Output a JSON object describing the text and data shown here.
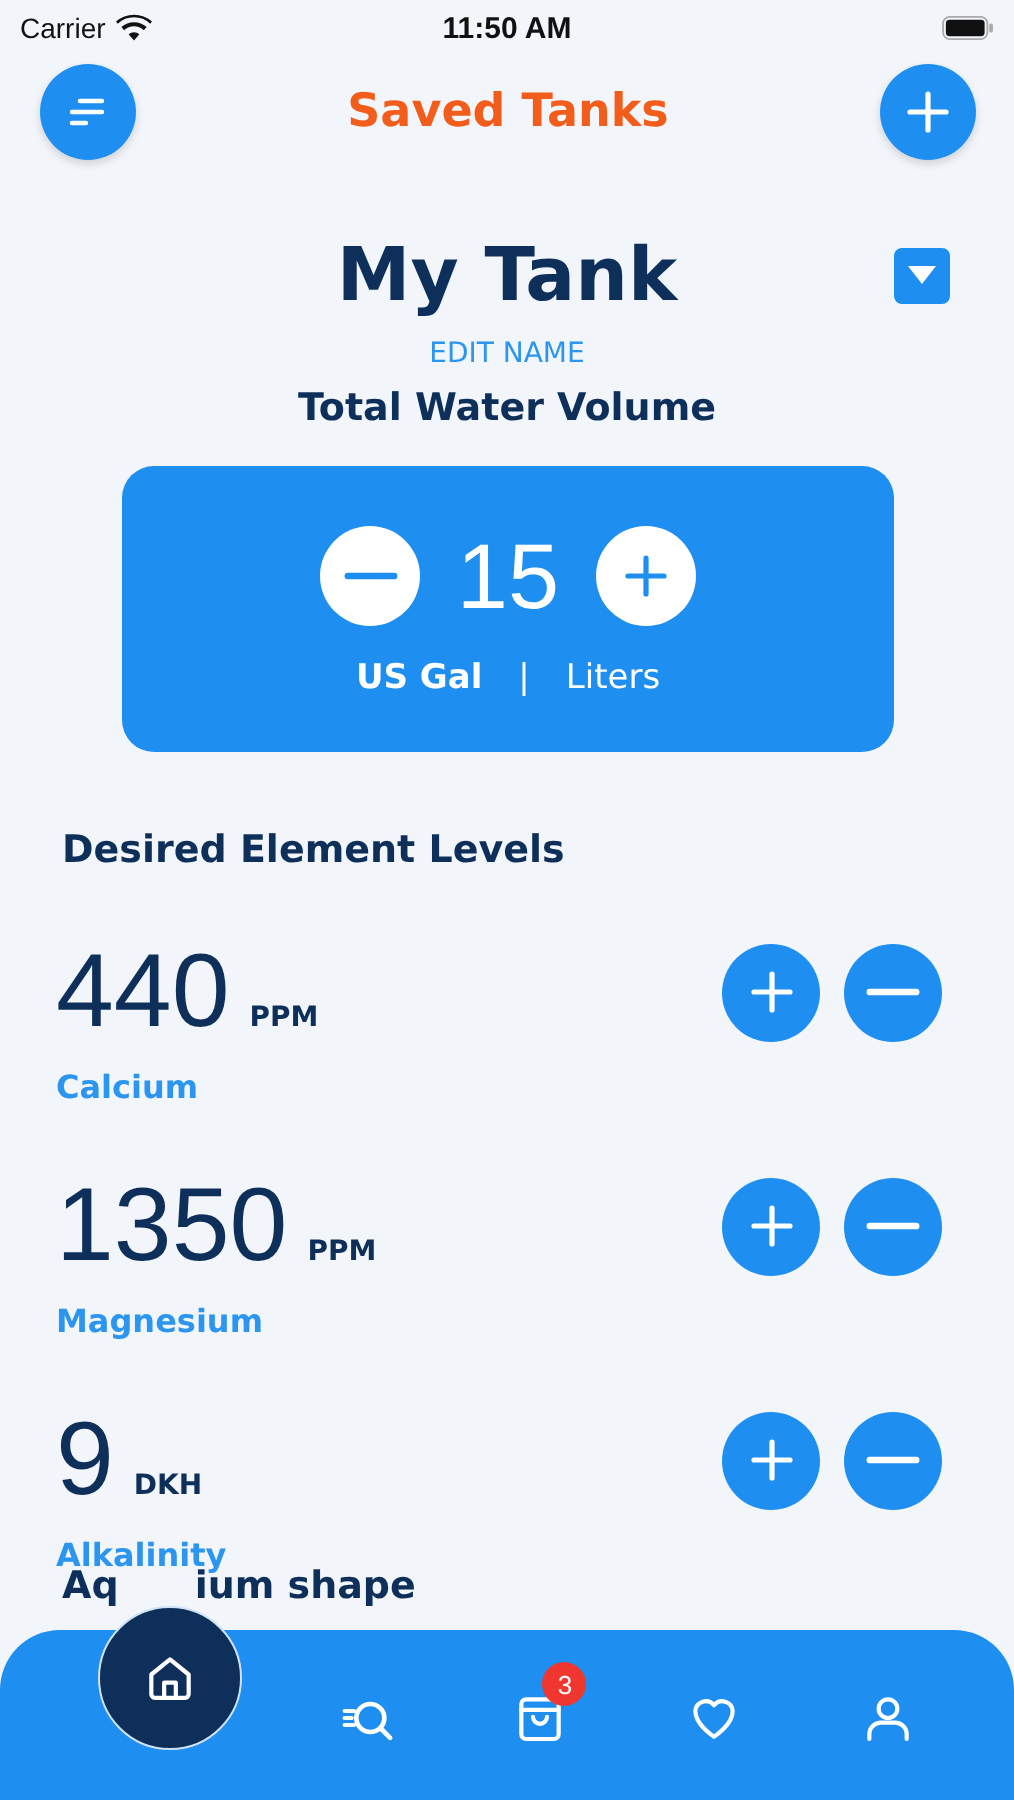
{
  "status_bar": {
    "carrier": "Carrier",
    "time": "11:50 AM"
  },
  "header": {
    "title": "Saved Tanks"
  },
  "tank": {
    "name": "My Tank",
    "edit_label": "EDIT NAME"
  },
  "volume": {
    "heading": "Total Water Volume",
    "value": "15",
    "units": [
      {
        "label": "US Gal",
        "selected": true
      },
      {
        "label": "Liters",
        "selected": false
      }
    ],
    "separator": "|"
  },
  "elements": {
    "heading": "Desired Element Levels",
    "items": [
      {
        "value": "440",
        "unit": "PPM",
        "name": "Calcium"
      },
      {
        "value": "1350",
        "unit": "PPM",
        "name": "Magnesium"
      },
      {
        "value": "9",
        "unit": "DKH",
        "name": "Alkalinity"
      }
    ]
  },
  "next_section": {
    "heading_fragments": [
      "Aq",
      "ium shape"
    ]
  },
  "tab_bar": {
    "items": [
      {
        "kind": "home",
        "selected": true
      },
      {
        "kind": "search",
        "selected": false
      },
      {
        "kind": "bag",
        "selected": false,
        "badge": "3"
      },
      {
        "kind": "heart",
        "selected": false
      },
      {
        "kind": "profile",
        "selected": false
      }
    ]
  }
}
